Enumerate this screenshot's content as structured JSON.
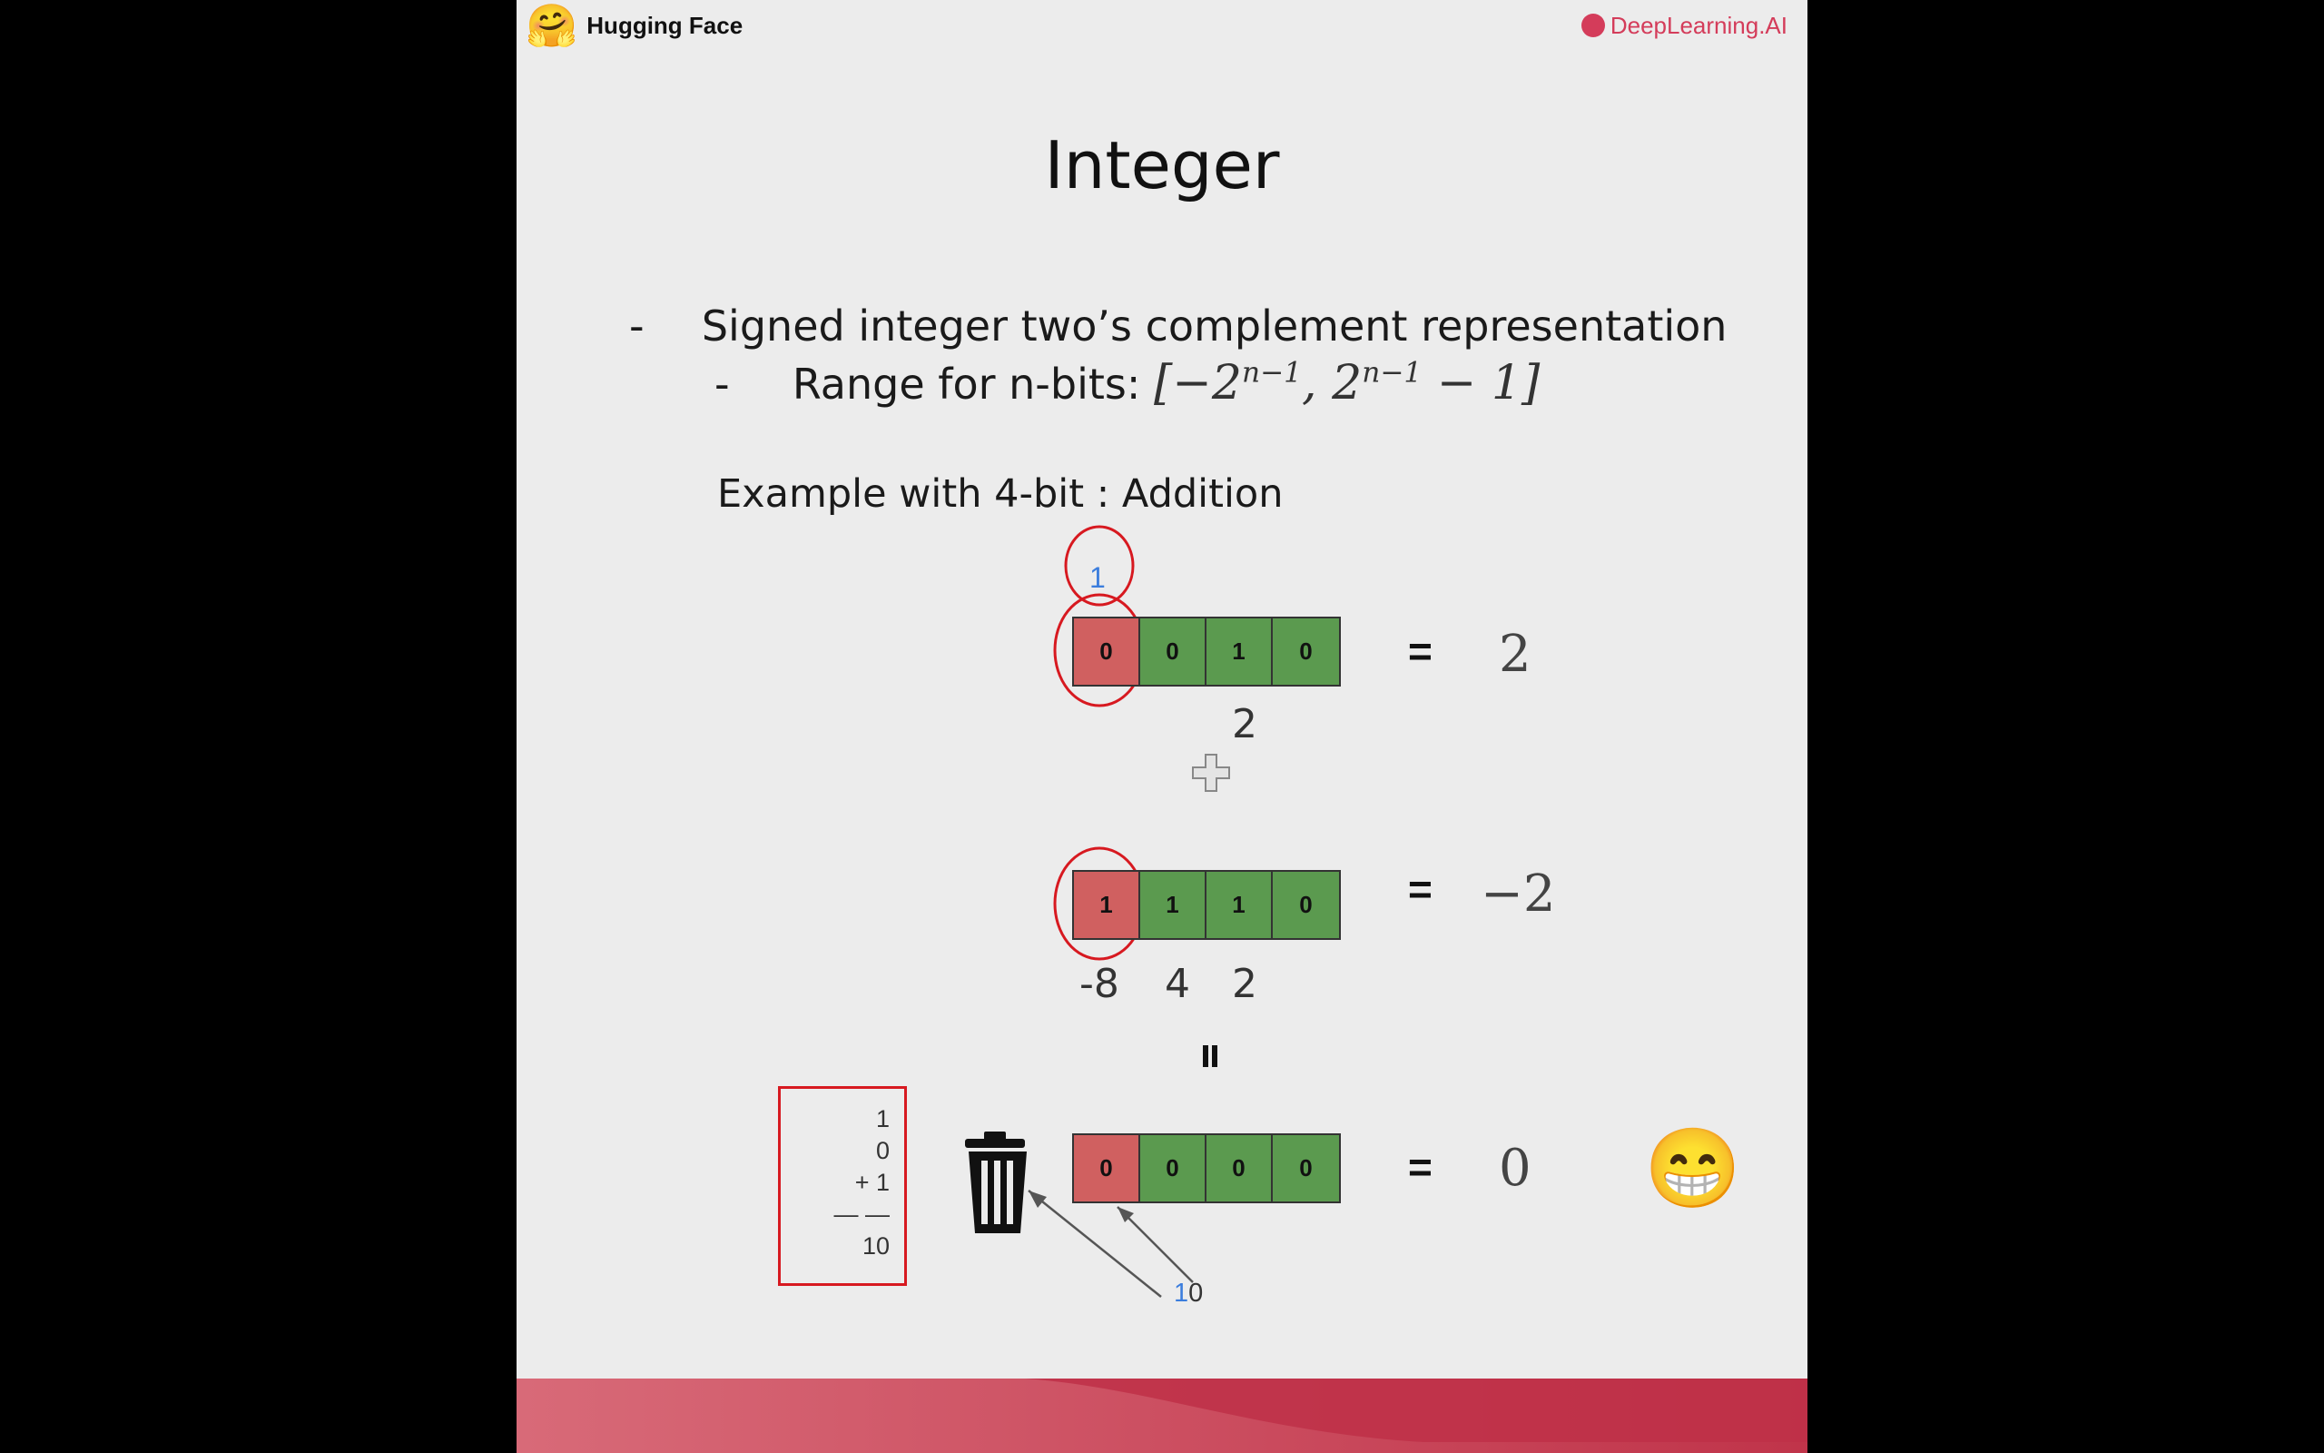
{
  "brand": {
    "left": "Hugging Face",
    "right": "DeepLearning.AI"
  },
  "title": "Integer",
  "bullets": {
    "main_dash": "-",
    "main": "Signed integer two’s complement representation",
    "sub_dash": "-",
    "sub_label": "Range for n-bits:",
    "range_open": "[−2",
    "range_exp1": "n−1",
    "range_mid": ", 2",
    "range_exp2": "n−1",
    "range_close": " − 1]"
  },
  "example": "Example with 4-bit : Addition",
  "carry": "1",
  "row1": {
    "bits": [
      "0",
      "0",
      "1",
      "0"
    ],
    "eq": "=",
    "value": "2",
    "weight_label": "2"
  },
  "plus": "✚",
  "row2": {
    "bits": [
      "1",
      "1",
      "1",
      "0"
    ],
    "eq": "=",
    "value": "−2",
    "weights": [
      "-8",
      "4",
      "2"
    ]
  },
  "equals_vertical": "=",
  "row3": {
    "bits": [
      "0",
      "0",
      "0",
      "0"
    ],
    "eq": "=",
    "value": "0"
  },
  "calc": {
    "line1": "1",
    "line2": "0",
    "line3": "+ 1",
    "line4": "— —",
    "line5": "10"
  },
  "overflow": {
    "blue": "1",
    "black": "0"
  },
  "emoji": "😁",
  "colors": {
    "sign_bit": "#d06060",
    "magnitude_bit": "#5b9a4f",
    "highlight": "#d71920",
    "carry_blue": "#3b7ddd"
  }
}
